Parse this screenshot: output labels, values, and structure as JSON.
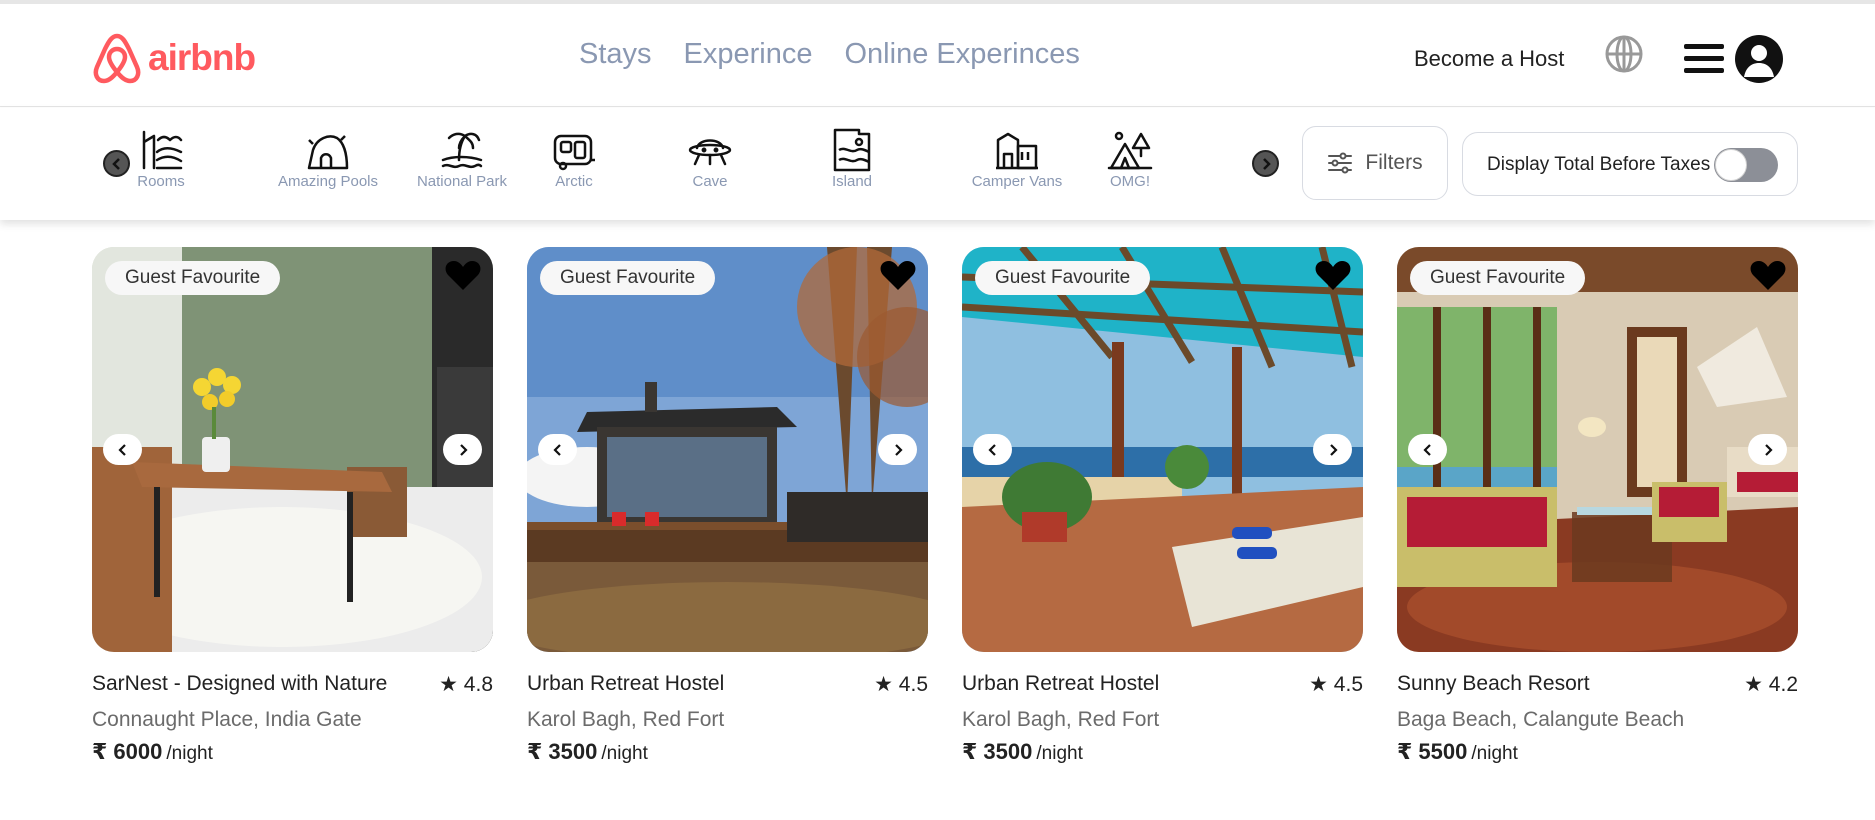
{
  "brand": {
    "name": "airbnb",
    "color": "#ff5a5f",
    "icon": "airbnb-logo-icon"
  },
  "nav": {
    "links": [
      {
        "label": "Stays"
      },
      {
        "label": "Experince"
      },
      {
        "label": "Online Experinces"
      }
    ]
  },
  "header": {
    "host_label": "Become a Host",
    "globe_icon": "globe-icon",
    "menu_icon": "hamburger-menu-icon",
    "avatar_icon": "user-avatar-icon"
  },
  "categories": {
    "items": [
      {
        "label": "Rooms",
        "icon": "rooms-icon"
      },
      {
        "label": "Amazing Pools",
        "icon": "amazing-pools-icon"
      },
      {
        "label": "National Park",
        "icon": "national-park-icon"
      },
      {
        "label": "Arctic",
        "icon": "arctic-icon"
      },
      {
        "label": "Cave",
        "icon": "cave-icon"
      },
      {
        "label": "Island",
        "icon": "island-icon"
      },
      {
        "label": "Camper Vans",
        "icon": "camper-vans-icon"
      },
      {
        "label": "OMG!",
        "icon": "omg-icon"
      }
    ],
    "prev_icon": "chevron-left-icon",
    "next_icon": "chevron-right-icon"
  },
  "filters": {
    "label": "Filters",
    "icon": "sliders-icon"
  },
  "taxes": {
    "label": "Display Total Before Taxes",
    "enabled": false
  },
  "listings": [
    {
      "badge": "Guest Favourite",
      "title": "SarNest - Designed with Nature",
      "rating": "★ 4.8",
      "location": "Connaught Place, India Gate",
      "price": "₹ 6000",
      "unit": "/night"
    },
    {
      "badge": "Guest Favourite",
      "title": "Urban Retreat Hostel",
      "rating": "★ 4.5",
      "location": "Karol Bagh, Red Fort",
      "price": "₹ 3500",
      "unit": "/night"
    },
    {
      "badge": "Guest Favourite",
      "title": "Urban Retreat Hostel",
      "rating": "★ 4.5",
      "location": "Karol Bagh, Red Fort",
      "price": "₹ 3500",
      "unit": "/night"
    },
    {
      "badge": "Guest Favourite",
      "title": "Sunny Beach Resort",
      "rating": "★ 4.2",
      "location": "Baga Beach, Calangute Beach",
      "price": "₹ 5500",
      "unit": "/night"
    }
  ],
  "colors": {
    "accent": "#ff5a5f",
    "nav_text": "#8a98b2",
    "category_text": "#8a98b2",
    "toggle_off": "#8c8f97"
  }
}
